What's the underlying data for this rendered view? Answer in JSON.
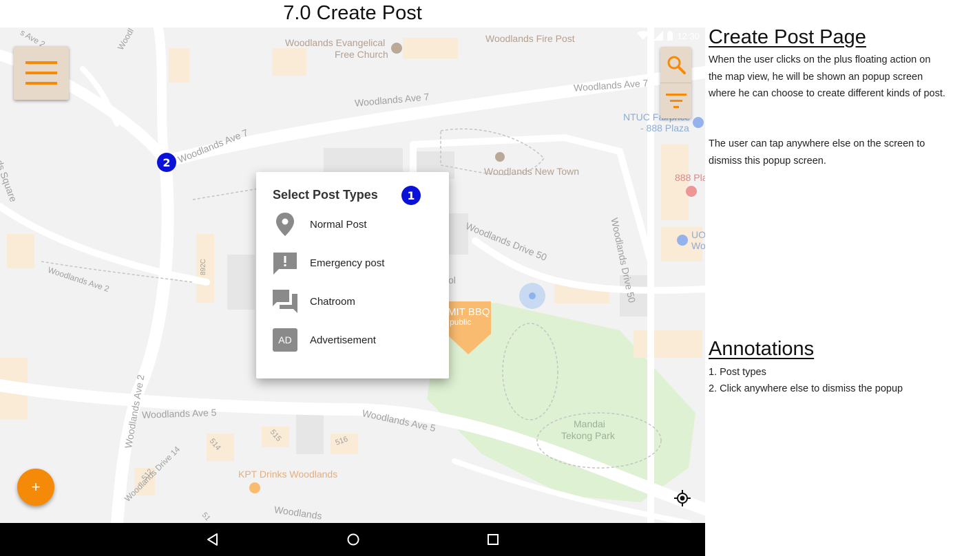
{
  "page": {
    "title": "7.0 Create Post"
  },
  "status_bar": {
    "time": "12:30"
  },
  "map": {
    "labels": {
      "church": "Woodlands Evangelical",
      "church2": "Free Church",
      "fire_post": "Woodlands Fire Post",
      "ave7_top": "Woodlands Ave 7",
      "ave7_mid": "Woodlands Ave 7",
      "ave7_left": "Woodlands Ave 7",
      "ntuc": "NTUC Fairprice",
      "ntuc2": "- 888 Plaza",
      "new_town": "Woodlands New Town",
      "plaza": "888 Pla",
      "drive50": "Woodlands Drive 50",
      "drive50_vert": "Woodlands Drive 50",
      "ave2_diag": "Woodlands Ave 2",
      "ave2_vert": "Woodlands Ave 2",
      "ave5_left": "Woodlands Ave 5",
      "ave5_right": "Woodlands Ave 5",
      "drive14": "Woodlands Drive 14",
      "bbq": "MIT BBQ",
      "bbq2": "public",
      "park": "Mandai",
      "park2": "Tekong Park",
      "kpt": "KPT Drinks Woodlands",
      "uo": "UO",
      "wo": "Wo",
      "square": "ds Square",
      "ave2_top": "s Ave 2",
      "blk_892c": "892C",
      "blk_514": "514",
      "blk_515": "515",
      "blk_516": "516",
      "blk_512": "512",
      "blk_51x": "51",
      "woodl_bottom": "Woodlands",
      "woodl_top": "Woodl",
      "ol": "ol"
    }
  },
  "dialog": {
    "title": "Select Post Types",
    "badge": "1",
    "options": [
      {
        "label": "Normal Post",
        "icon": "location-pin-icon"
      },
      {
        "label": "Emergency post",
        "icon": "alert-message-icon"
      },
      {
        "label": "Chatroom",
        "icon": "chat-bubbles-icon"
      },
      {
        "label": "Advertisement",
        "icon": "ad-icon",
        "icon_text": "AD"
      }
    ]
  },
  "annotation_badge_2": "2",
  "fab": {
    "label": "+"
  },
  "colors": {
    "accent": "#f58a09",
    "badge": "#0a12d8",
    "menu_bg": "#e7d9ca"
  },
  "sidebar": {
    "heading": "Create Post Page",
    "paragraph1": "When the user clicks on the plus floating action on the map view, he will be shown an popup screen where he can choose to create different kinds of post.",
    "paragraph2": "The user can tap anywhere else on the screen to dismiss this popup screen.",
    "annotations_heading": "Annotations",
    "annotations": [
      "1. Post types",
      "2. Click anywhere else to dismiss the popup"
    ]
  }
}
